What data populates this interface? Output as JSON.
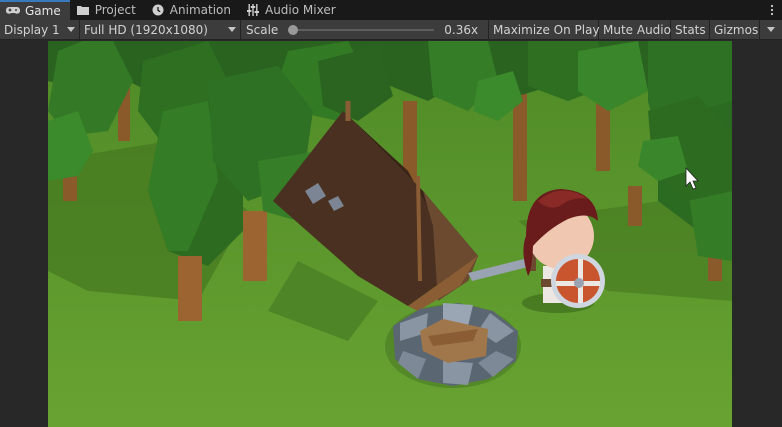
{
  "tabs": [
    {
      "label": "Game",
      "icon": "gamepad-icon",
      "active": true
    },
    {
      "label": "Project",
      "icon": "folder-icon",
      "active": false
    },
    {
      "label": "Animation",
      "icon": "clock-icon",
      "active": false
    },
    {
      "label": "Audio Mixer",
      "icon": "sliders-icon",
      "active": false
    }
  ],
  "toolbar": {
    "display": "Display 1",
    "resolution": "Full HD (1920x1080)",
    "scale_label": "Scale",
    "scale_value": "0.36x",
    "scale_fraction": 0.0,
    "maximize": "Maximize On Play",
    "mute": "Mute Audio",
    "stats": "Stats",
    "gizmos": "Gizmos"
  },
  "colors": {
    "accent": "#3a79bb",
    "panel": "#3c3c3c",
    "ground": "#5f9c2e",
    "foliage": "#2f6e22",
    "tent": "#4a3020"
  }
}
